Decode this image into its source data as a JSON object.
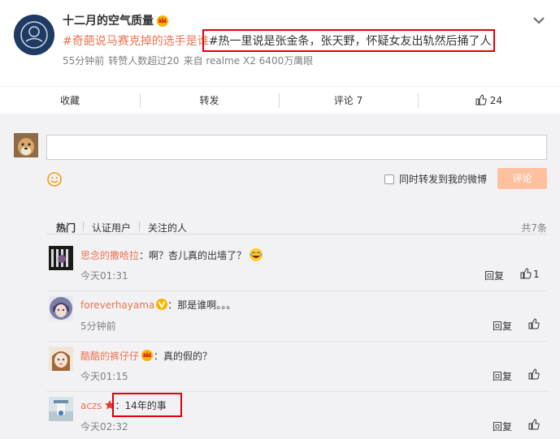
{
  "post": {
    "username": "十二月的空气质量",
    "text_topic": "#奇葩说马赛克掉的选手是谁",
    "text_body": "#热一里说是张金条，张天野，怀疑女友出轨然后捅了人",
    "meta": {
      "time": "55分钟前",
      "reposts": "转赞人数超过20",
      "source": "来自 realme X2 6400万鹰眼"
    }
  },
  "actions": {
    "favorite": "收藏",
    "repost": "转发",
    "comment": "评论 7",
    "like_count": "24"
  },
  "composer": {
    "repost_label": "同时转发到我的微博",
    "submit_label": "评论"
  },
  "filters": {
    "hot": "热门",
    "verified": "认证用户",
    "following": "关注的人",
    "total": "共7条"
  },
  "comments": [
    {
      "name": "思念的撒哈拉",
      "text": "：啊？杏儿真的出墙了？",
      "time": "今天01:31",
      "reply": "回复",
      "likes": "1"
    },
    {
      "name": "foreverhayama",
      "text": "：那是谁啊。。。",
      "time": "5分钟前",
      "reply": "回复",
      "likes": ""
    },
    {
      "name": "酷酷的裤仔仔",
      "text": "：真的假的？",
      "time": "今天01:15",
      "reply": "回复",
      "likes": ""
    },
    {
      "name": "aczs",
      "text": "：14年的事",
      "time": "今天02:32",
      "reply": "回复",
      "likes": ""
    }
  ],
  "colors": {
    "accent": "#eb7350",
    "highlight_box": "#e0000b",
    "submit_disabled": "#ffc09f"
  }
}
